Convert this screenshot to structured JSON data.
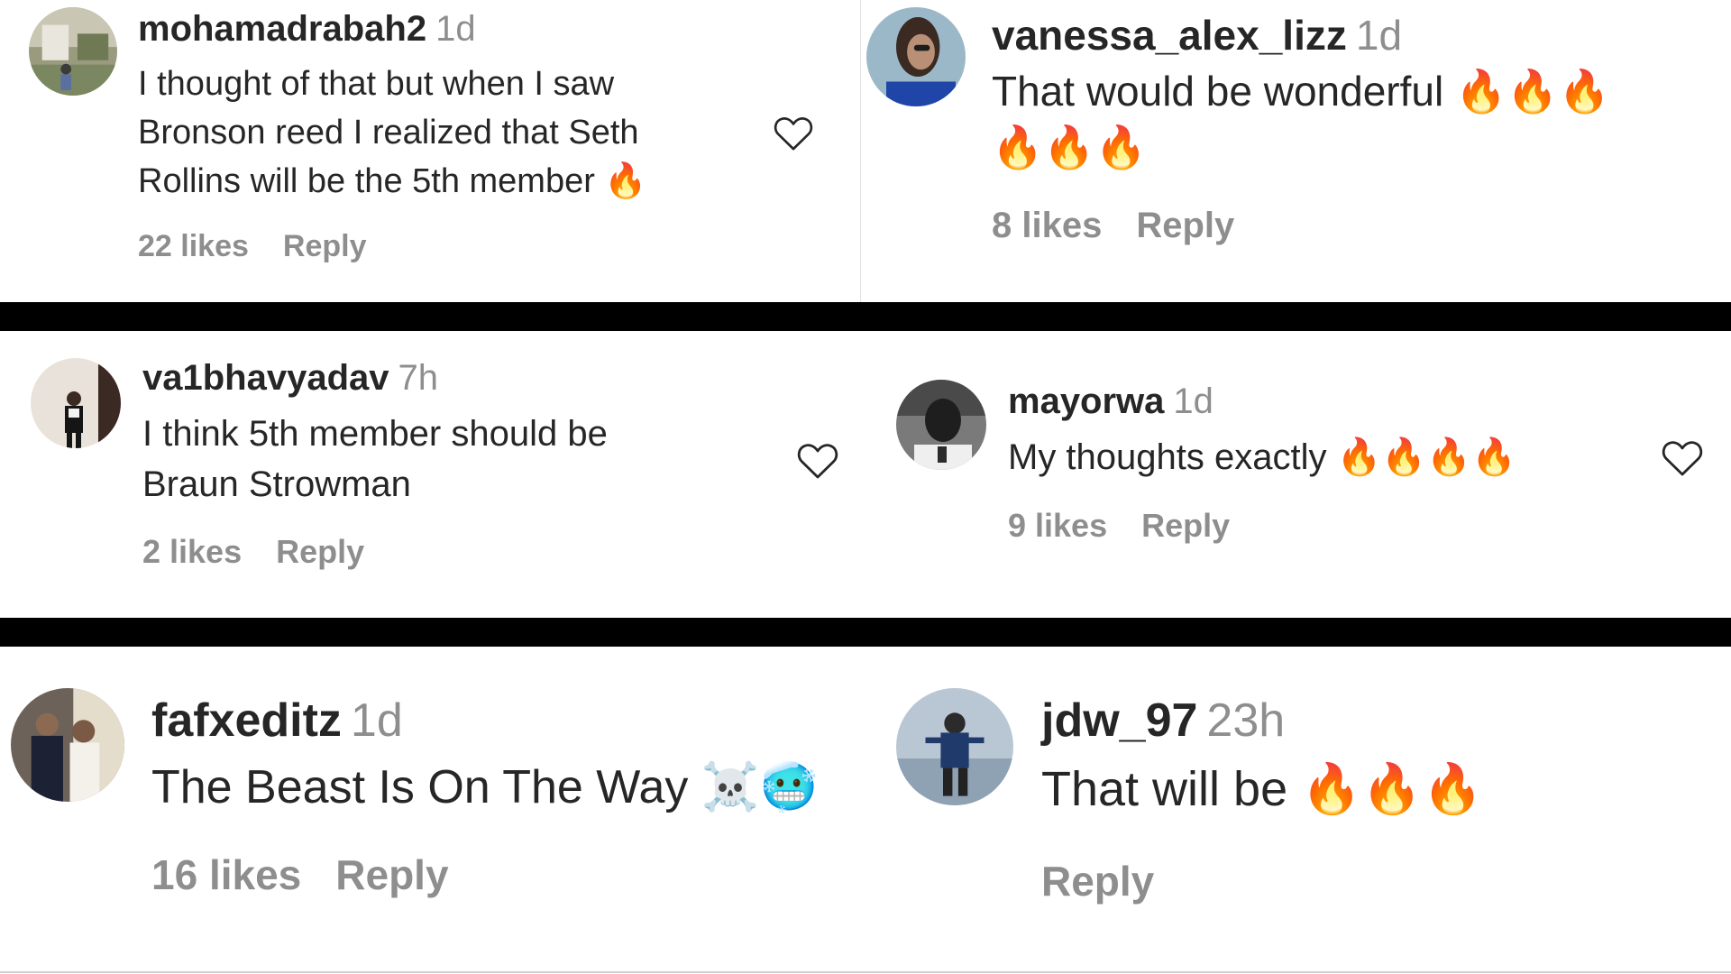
{
  "comments": [
    {
      "username": "mohamadrabah2",
      "time": "1d",
      "text": "I thought of that but when I saw\nBronson reed I realized that Seth\nRollins will be the 5th member 🔥",
      "likes": "22 likes",
      "reply": "Reply"
    },
    {
      "username": "vanessa_alex_lizz",
      "time": "1d",
      "text": "That would be wonderful 🔥🔥🔥\n🔥🔥🔥",
      "likes": "8 likes",
      "reply": "Reply"
    },
    {
      "username": "va1bhavyadav",
      "time": "7h",
      "text": "I think 5th member should be\nBraun Strowman",
      "likes": "2 likes",
      "reply": "Reply"
    },
    {
      "username": "mayorwa",
      "time": "1d",
      "text": "My thoughts exactly 🔥🔥🔥🔥",
      "likes": "9 likes",
      "reply": "Reply"
    },
    {
      "username": "fafxeditz",
      "time": "1d",
      "text": "The Beast Is On The Way ☠️🥶",
      "likes": "16 likes",
      "reply": "Reply"
    },
    {
      "username": "jdw_97",
      "time": "23h",
      "text": "That will be 🔥🔥🔥",
      "reply": "Reply"
    }
  ],
  "icons": {
    "like": "heart-outline-icon"
  },
  "colors": {
    "text": "#262626",
    "secondary": "#8e8e8e",
    "separator": "#000000"
  }
}
